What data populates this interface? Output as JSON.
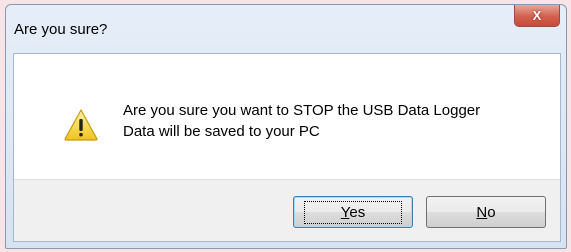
{
  "dialog": {
    "title": "Are you sure?",
    "close_label": "X",
    "message_line1": "Are you sure you want to STOP the USB Data Logger",
    "message_line2": "Data will be saved to your PC",
    "icon": "warning-icon",
    "buttons": {
      "yes_label": "Yes",
      "no_label": "No"
    }
  }
}
